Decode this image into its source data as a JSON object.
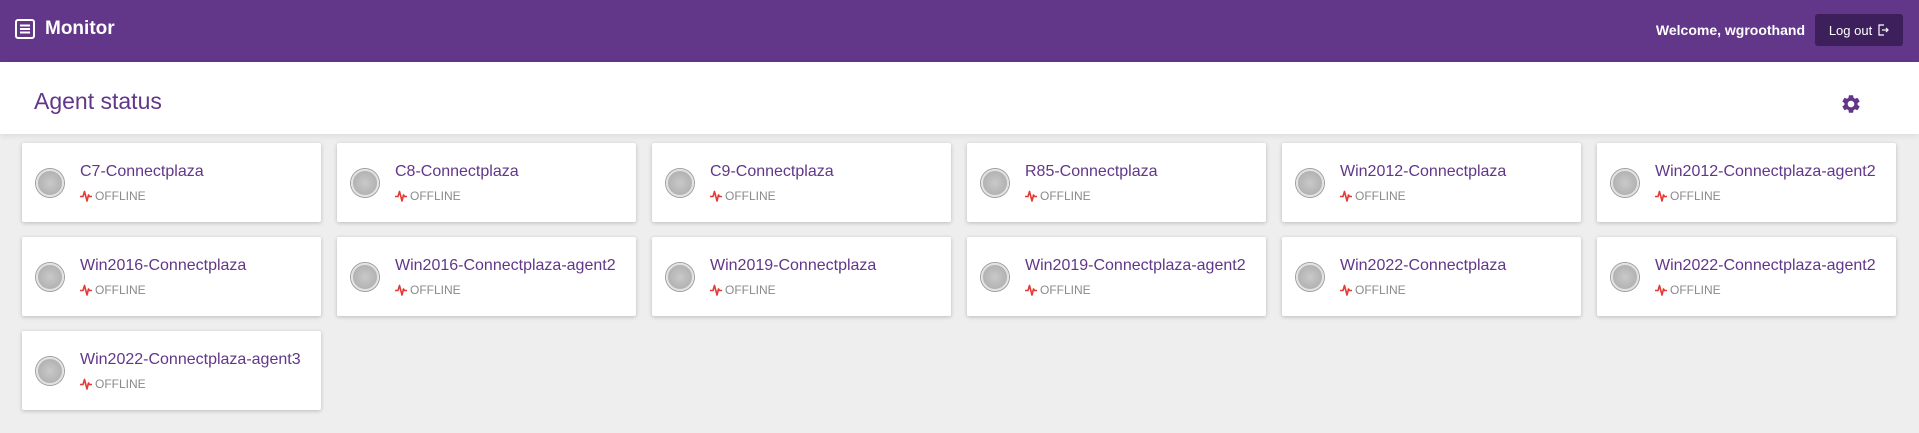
{
  "topbar": {
    "app_title": "Monitor",
    "welcome_text": "Welcome, wgroothand",
    "logout_label": "Log out",
    "menu_icon": "list-icon",
    "logout_icon": "logout-icon",
    "background_color": "#623689"
  },
  "header": {
    "page_title": "Agent status",
    "settings_icon": "gear-icon"
  },
  "agents": [
    {
      "name": "C7-Connectplaza",
      "status": "OFFLINE"
    },
    {
      "name": "C8-Connectplaza",
      "status": "OFFLINE"
    },
    {
      "name": "C9-Connectplaza",
      "status": "OFFLINE"
    },
    {
      "name": "R85-Connectplaza",
      "status": "OFFLINE"
    },
    {
      "name": "Win2012-Connectplaza",
      "status": "OFFLINE"
    },
    {
      "name": "Win2012-Connectplaza-agent2",
      "status": "OFFLINE"
    },
    {
      "name": "Win2016-Connectplaza",
      "status": "OFFLINE"
    },
    {
      "name": "Win2016-Connectplaza-agent2",
      "status": "OFFLINE"
    },
    {
      "name": "Win2019-Connectplaza",
      "status": "OFFLINE"
    },
    {
      "name": "Win2019-Connectplaza-agent2",
      "status": "OFFLINE"
    },
    {
      "name": "Win2022-Connectplaza",
      "status": "OFFLINE"
    },
    {
      "name": "Win2022-Connectplaza-agent2",
      "status": "OFFLINE"
    },
    {
      "name": "Win2022-Connectplaza-agent3",
      "status": "OFFLINE"
    }
  ],
  "colors": {
    "accent": "#623689",
    "offline_icon": "#e53935",
    "status_text": "#8a8a8a"
  }
}
